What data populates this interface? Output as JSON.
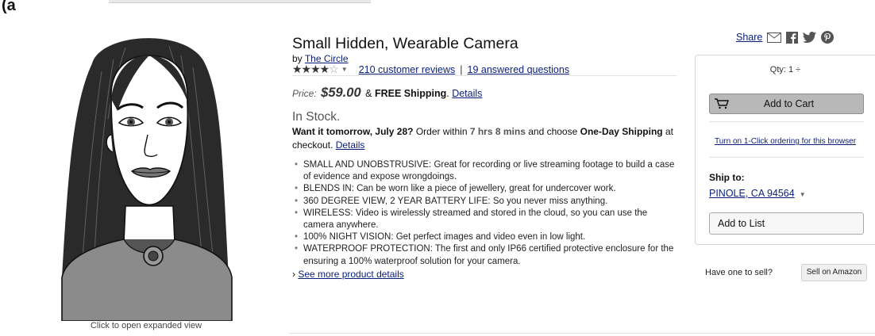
{
  "panel_label": "(a",
  "image": {
    "caption": "Click to open expanded view"
  },
  "product": {
    "title": "Small Hidden, Wearable Camera",
    "by_prefix": "by",
    "brand": "The Circle",
    "rating_stars": 4.5,
    "reviews_link": "210 customer reviews",
    "separator": "|",
    "questions_link": "19 answered questions",
    "price_label": "Price:",
    "price": "$59.00",
    "shipping_amp": "&",
    "shipping_text": "FREE Shipping",
    "shipping_period": ".",
    "shipping_details": "Details",
    "stock": "In Stock.",
    "delivery": {
      "want": "Want it tomorrow, July 28?",
      "order_within": "Order within",
      "countdown": "7 hrs 8 mins",
      "and_choose": "and choose",
      "option": "One-Day Shipping",
      "at_checkout": "at checkout.",
      "details": "Details"
    },
    "bullets": [
      "SMALL AND UNOBSTRUSIVE: Great for recording or live streaming footage to build a case of evidence and expose wrongdoings.",
      "BLENDS IN: Can be worn like a piece of jewellery, great for undercover work.",
      "360 DEGREE VIEW, 2 YEAR BATTERY LIFE: So you never miss anything.",
      "WIRELESS: Video is wirelessly streamed and stored in the cloud, so you can use the camera anywhere.",
      "100% NIGHT VISION: Get perfect images and video even in low light.",
      "WATERPROOF PROTECTION: The first and only IP66 certified protective enclosure for the ensuring a 100% waterproof solution for your camera."
    ],
    "more_prefix": "›",
    "more_link": "See more product details"
  },
  "share": {
    "label": "Share",
    "icons": [
      "email-icon",
      "facebook-icon",
      "twitter-icon",
      "pinterest-icon"
    ]
  },
  "buybox": {
    "qty": "Qty: 1 ÷",
    "add_to_cart": "Add to Cart",
    "one_click": "Turn on 1-Click ordering for this browser",
    "ship_to_label": "Ship to:",
    "ship_to_location": "PINOLE, CA 94564",
    "add_to_list": "Add to List"
  },
  "sell": {
    "question": "Have one to sell?",
    "button": "Sell on Amazon"
  },
  "colors": {
    "link": "#0a1f7a",
    "cart_button": "#b8b8b8",
    "border": "#d5d5d5"
  }
}
